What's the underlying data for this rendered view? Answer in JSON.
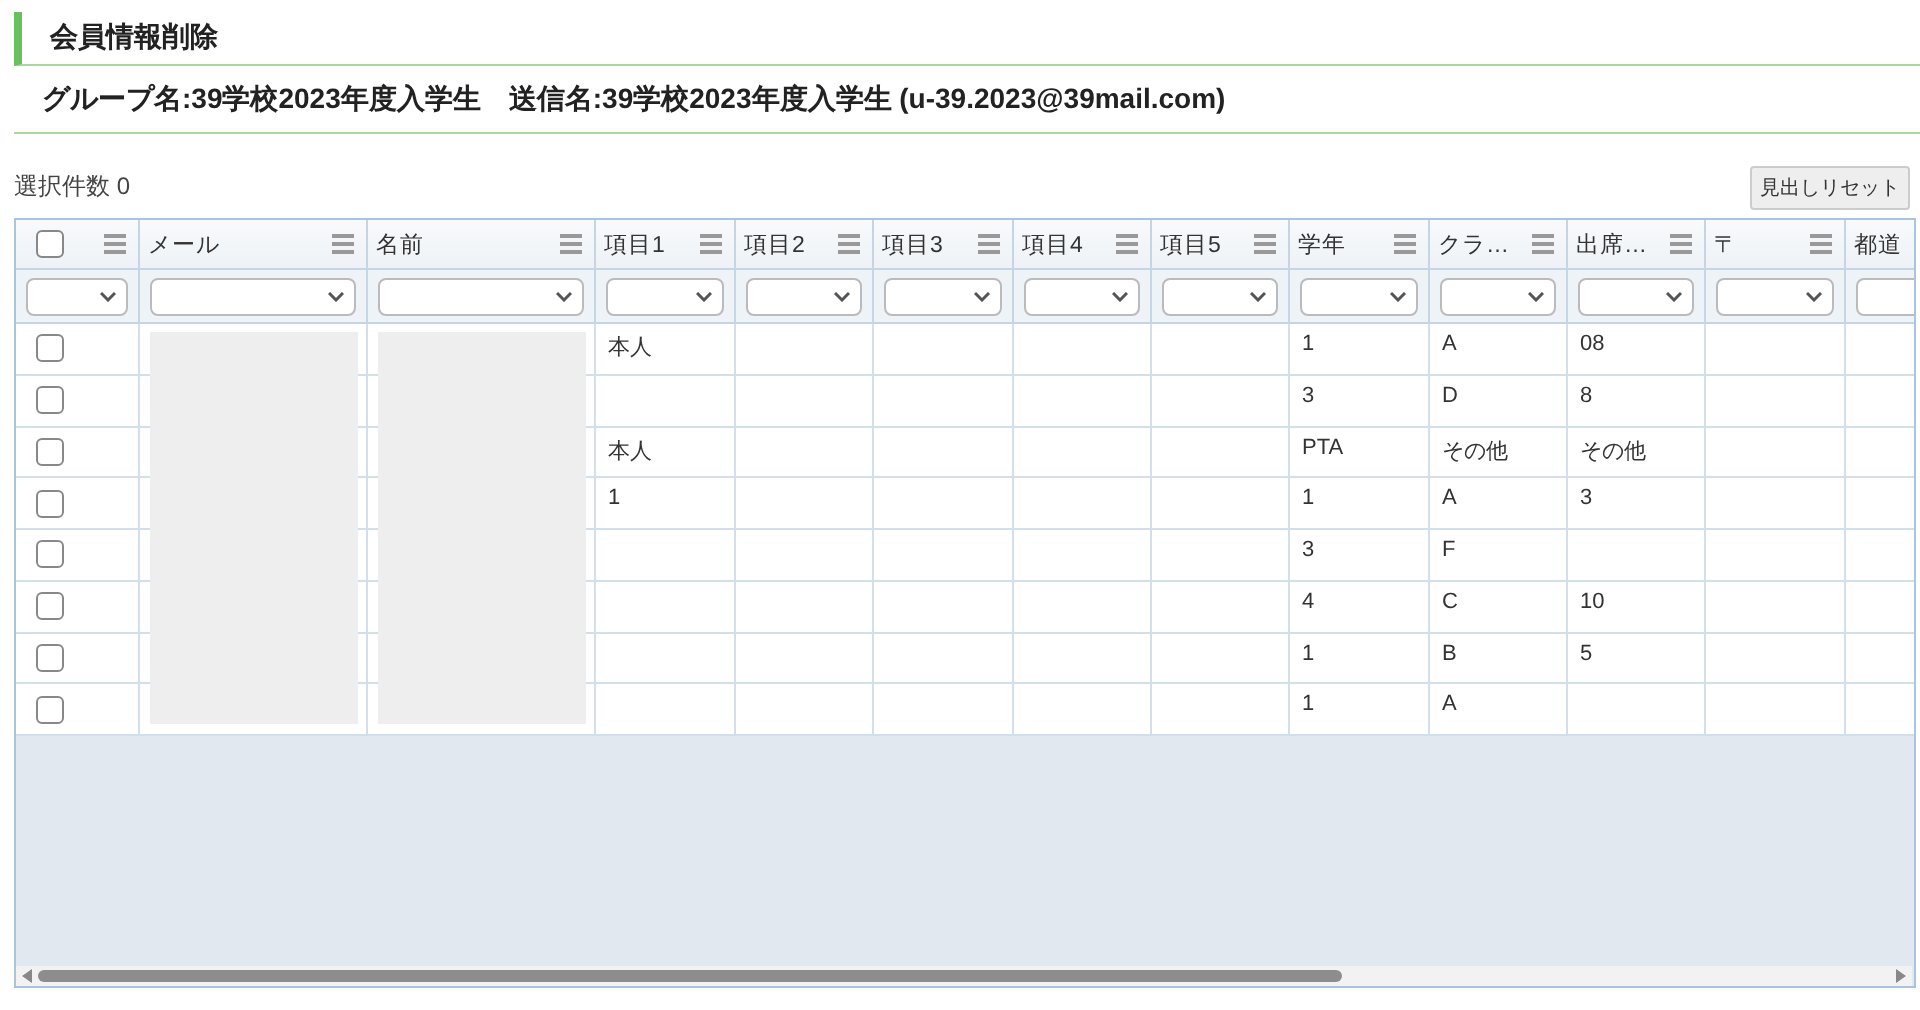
{
  "page_title": "会員情報削除",
  "group_info": "グループ名:39学校2023年度入学生　送信名:39学校2023年度入学生 (u-39.2023@39mail.com)",
  "selected_count": "選択件数 0",
  "reset_button": "見出しリセット",
  "table": {
    "select_all": {
      "checked": false
    },
    "columns": [
      {
        "label": "メール",
        "redacted": true
      },
      {
        "label": "名前",
        "redacted": true
      },
      {
        "label": "項目1",
        "redacted": false
      },
      {
        "label": "項目2",
        "redacted": false
      },
      {
        "label": "項目3",
        "redacted": false
      },
      {
        "label": "項目4",
        "redacted": false
      },
      {
        "label": "項目5",
        "redacted": false
      },
      {
        "label": "学年",
        "redacted": false
      },
      {
        "label": "クラ…",
        "redacted": false
      },
      {
        "label": "出席…",
        "redacted": false
      },
      {
        "label": "〒",
        "redacted": false
      },
      {
        "label": "都道",
        "redacted": false
      }
    ],
    "rows": [
      {
        "checked": false,
        "item_1": "本人",
        "grade": "1",
        "class": "A",
        "attendance": "08"
      },
      {
        "checked": false,
        "grade": "3",
        "class": "D",
        "attendance": "8"
      },
      {
        "checked": false,
        "item_1": "本人",
        "grade": "PTA",
        "class": "その他",
        "attendance": "その他"
      },
      {
        "checked": false,
        "item_1": "1",
        "grade": "1",
        "class": "A",
        "attendance": "3"
      },
      {
        "checked": false,
        "grade": "3",
        "class": "F"
      },
      {
        "checked": false,
        "grade": "4",
        "class": "C",
        "attendance": "10"
      },
      {
        "checked": false,
        "grade": "1",
        "class": "B",
        "attendance": "5"
      },
      {
        "checked": false,
        "grade": "1",
        "class": "A"
      }
    ]
  }
}
